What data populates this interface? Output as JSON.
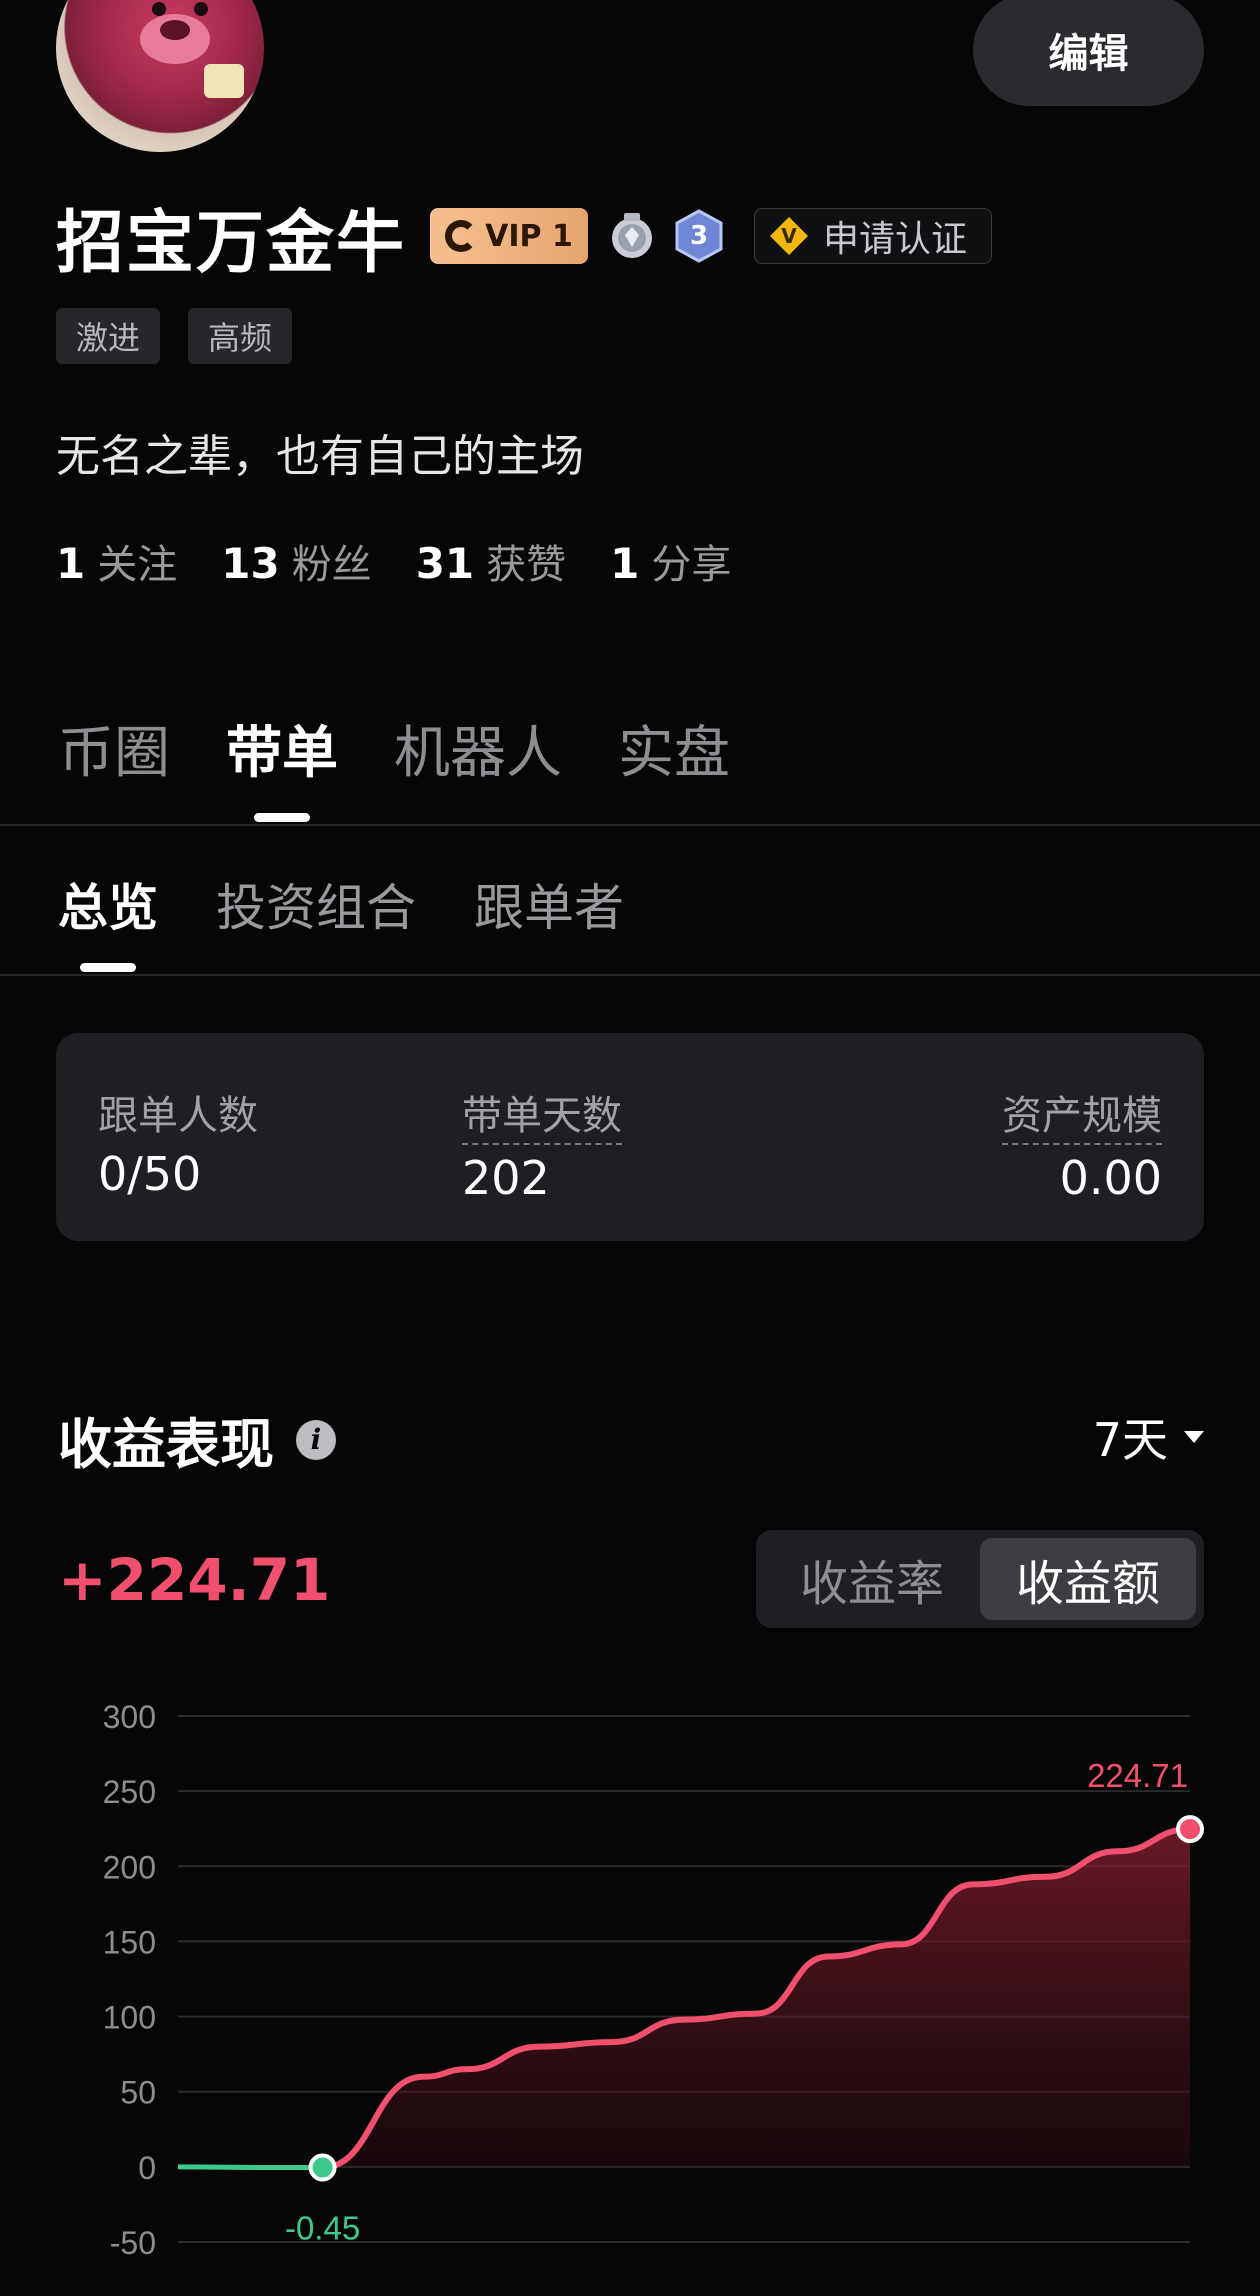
{
  "profile": {
    "name": "招宝万金牛",
    "vip_label": "VIP 1",
    "hex_level": "3",
    "verify_label": "申请认证",
    "verify_badge": "V",
    "edit_label": "编辑",
    "tags": [
      "激进",
      "高频"
    ],
    "bio": "无名之辈，也有自己的主场",
    "stats": [
      {
        "num": "1",
        "label": "关注"
      },
      {
        "num": "13",
        "label": "粉丝"
      },
      {
        "num": "31",
        "label": "获赞"
      },
      {
        "num": "1",
        "label": "分享"
      }
    ]
  },
  "main_tabs": [
    {
      "label": "币圈",
      "active": false
    },
    {
      "label": "带单",
      "active": true
    },
    {
      "label": "机器人",
      "active": false
    },
    {
      "label": "实盘",
      "active": false
    }
  ],
  "sub_tabs": [
    {
      "label": "总览",
      "active": true
    },
    {
      "label": "投资组合",
      "active": false
    },
    {
      "label": "跟单者",
      "active": false
    }
  ],
  "overview": {
    "followers_label": "跟单人数",
    "followers_value": "0/50",
    "days_label": "带单天数",
    "days_value": "202",
    "aum_label": "资产规模",
    "aum_value": "0.00"
  },
  "performance": {
    "title": "收益表现",
    "range": "7天",
    "pnl": "+224.71",
    "toggle": [
      {
        "label": "收益率",
        "active": false
      },
      {
        "label": "收益额",
        "active": true
      }
    ]
  },
  "colors": {
    "accent_red": "#f0506e",
    "accent_green": "#3ec98c",
    "background": "#060606"
  },
  "chart_data": {
    "type": "area",
    "title": "",
    "xlabel": "",
    "ylabel": "",
    "ylim": [
      -50,
      300
    ],
    "yticks": [
      300,
      250,
      200,
      150,
      100,
      50,
      0,
      -50
    ],
    "grid": true,
    "series": [
      {
        "x": [
          0,
          0.7,
          1,
          1.7,
          2,
          2.5,
          3,
          3.5,
          4,
          4.5,
          5,
          5.5,
          6,
          6.5,
          7
        ],
        "values": [
          0,
          -0.45,
          -0.45,
          60,
          65,
          80,
          83,
          98,
          102,
          140,
          148,
          188,
          193,
          210,
          224.71
        ]
      }
    ],
    "annotations": [
      {
        "label": "224.71",
        "x": 7,
        "y": 224.71,
        "color": "#f0506e"
      },
      {
        "label": "-0.45",
        "x": 1,
        "y": -0.45,
        "color": "#3ec98c"
      }
    ]
  }
}
